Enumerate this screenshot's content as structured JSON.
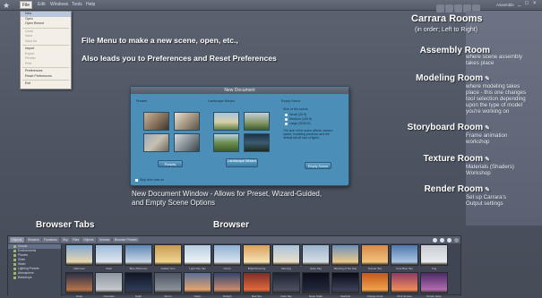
{
  "menubar": {
    "logo": "★",
    "items": [
      "File",
      "Edit",
      "Windows",
      "Tools",
      "Help"
    ],
    "user_label": "Assemble",
    "controls": [
      "_",
      "□",
      "×"
    ]
  },
  "file_menu": {
    "items": [
      "New",
      "Open",
      "Open Recent",
      "Close",
      "Save",
      "Save As",
      "Import",
      "Export",
      "Render",
      "Print",
      "Preferences",
      "Reset Preferences",
      "Exit"
    ]
  },
  "annotations": {
    "file_menu_line1": "File Menu to make a new scene, open, etc.,",
    "file_menu_line2": "Also leads you to Preferences and Reset Preferences",
    "new_doc_line1": "New Document Window - Allows for Preset, Wizard-Guided,",
    "new_doc_line2": "and Empty Scene Options",
    "browser_tabs": "Browser Tabs",
    "browser": "Browser"
  },
  "rooms": {
    "title": "Carrara Rooms",
    "subtitle": "(in order; Left to Right)",
    "list": [
      {
        "name": "Assembly Room",
        "desc": [
          "where scene assembly",
          "takes place"
        ]
      },
      {
        "name": "Modeling Room",
        "desc": [
          "where modeling takes",
          "place - this one changes",
          "tool selection depending",
          "upon the type of model",
          "you're working on"
        ]
      },
      {
        "name": "Storyboard Room",
        "desc": [
          "Frame animation",
          "workshop"
        ]
      },
      {
        "name": "Texture Room",
        "desc": [
          "Materials (Shaders)",
          "Workshop"
        ]
      },
      {
        "name": "Render Room",
        "desc": [
          "Set up Carrara's",
          "Output settings"
        ]
      }
    ]
  },
  "dialog": {
    "title": "New Document",
    "sections": [
      {
        "label": "Presets",
        "button": "Presets"
      },
      {
        "label": "Landscape Wizard",
        "button": "Landscape Wizard"
      },
      {
        "label": "Empty Scene",
        "button": "Empty Scene"
      }
    ],
    "size_label": "Size of the scene",
    "sizes": [
      "Small (20 ft)",
      "Medium (100 ft)",
      "Large (5000 ft)"
    ],
    "note": "The size of the scene affects camera speed, modeling precision and the default fall off size of lights.",
    "checkbox": "Skip from now on"
  },
  "browser": {
    "tabs": [
      "Objects",
      "Shaders",
      "Functions",
      "Sky",
      "Files",
      "Objects",
      "Scenes",
      "Browser Presets"
    ],
    "tree": [
      "Clouds",
      "Environments",
      "Planets",
      "Skies",
      "Water",
      "Lighting Presets",
      "Atmosphere",
      "Backdrops"
    ],
    "top_row": [
      "Afternoon",
      "Clear",
      "Blue Afternoon",
      "Golden Sun",
      "Light Day Sky",
      "Cirrus",
      "Bright Evening",
      "Morning",
      "Haze Sky",
      "Morning of the Sun",
      "Sunset Sky",
      "Cool Blue Sky",
      "Fog"
    ],
    "bottom_row": [
      "Dusk",
      "Overcast",
      "Night",
      "Storm",
      "Dawn",
      "Twilight",
      "Red Sky",
      "Dark Sky",
      "Deep Night",
      "Starfield",
      "Orange Dusk",
      "Pink Sunset",
      "Purple Haze"
    ]
  }
}
